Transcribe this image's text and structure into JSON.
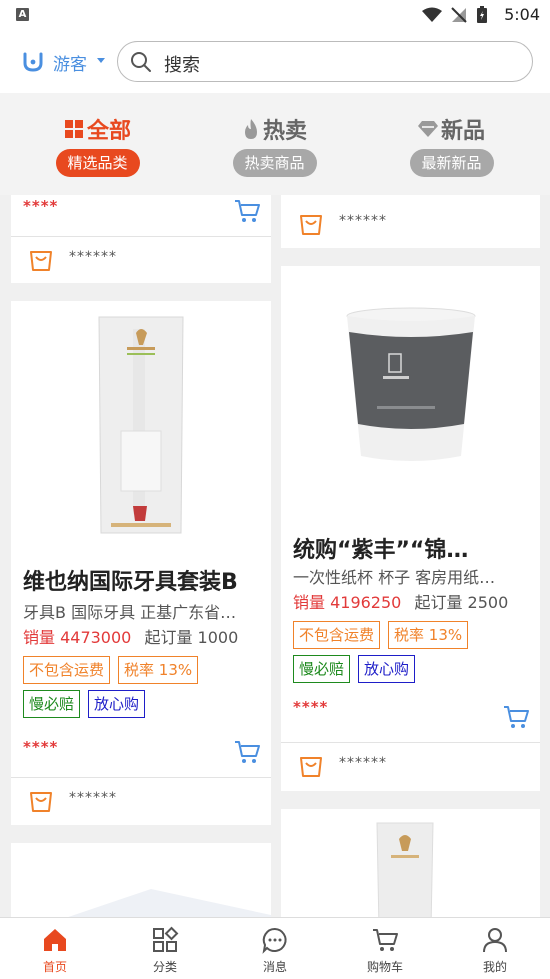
{
  "status_bar": {
    "indicator": "A",
    "time": "5:04"
  },
  "header": {
    "user_label": "游客",
    "search_placeholder": "搜索"
  },
  "tabs": [
    {
      "title": "全部",
      "pill": "精选品类",
      "active": true
    },
    {
      "title": "热卖",
      "pill": "热卖商品",
      "active": false
    },
    {
      "title": "新品",
      "pill": "最新新品",
      "active": false
    }
  ],
  "cards": {
    "left_top": {
      "stars": "****",
      "shop_name": "******"
    },
    "right_top": {
      "shop_name": "******"
    },
    "left_product": {
      "title": "维也纳国际牙具套装B",
      "subtitle": "牙具B 国际牙具 正基广东省…",
      "sales": "销量 4473000",
      "moq": "起订量 1000",
      "tags_row1": [
        "不包含运费",
        "税率 13%"
      ],
      "tags_row2": [
        "慢必赔",
        "放心购"
      ],
      "stars": "****",
      "shop_name": "******"
    },
    "right_product": {
      "title": "统购“紫丰”“锦…",
      "subtitle": "一次性纸杯 杯子 客房用纸…",
      "sales": "销量 4196250",
      "moq": "起订量 2500",
      "tags_row1": [
        "不包含运费",
        "税率 13%"
      ],
      "tags_row2": [
        "慢必赔",
        "放心购"
      ],
      "stars": "****",
      "shop_name": "******"
    }
  },
  "bottom_nav": [
    {
      "label": "首页",
      "icon": "home-icon",
      "active": true
    },
    {
      "label": "分类",
      "icon": "category-icon",
      "active": false
    },
    {
      "label": "消息",
      "icon": "message-icon",
      "active": false
    },
    {
      "label": "购物车",
      "icon": "cart-icon",
      "active": false
    },
    {
      "label": "我的",
      "icon": "profile-icon",
      "active": false
    }
  ],
  "colors": {
    "accent": "#e8491f",
    "inactive_pill": "#a8a8a8",
    "link": "#4a8fe0",
    "price": "#e23a3a"
  }
}
